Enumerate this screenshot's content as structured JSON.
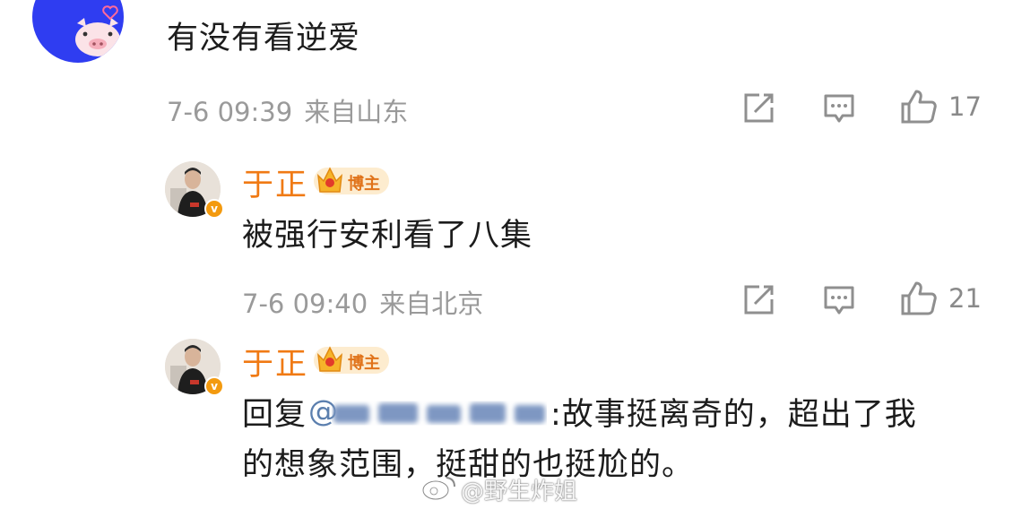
{
  "comment": {
    "text": "有没有看逆爱",
    "time": "7-6 09:39",
    "location": "来自山东",
    "like_count": "17"
  },
  "replies": [
    {
      "username": "于正",
      "badge": "博主",
      "text": "被强行安利看了八集",
      "time": "7-6 09:40",
      "location": "来自北京",
      "like_count": "21"
    },
    {
      "username": "于正",
      "badge": "博主",
      "reply_prefix": "回复",
      "mention": "@",
      "text_line1": ":故事挺离奇的，超出了我",
      "text_line2": "的想象范围，挺甜的也挺尬的。"
    }
  ],
  "watermark": "@野生炸姐",
  "verified_mark": "v",
  "icons": [
    "pig-avatar-icon",
    "share-icon",
    "comment-icon",
    "like-icon",
    "verified-icon",
    "crown-icon",
    "weibo-logo-icon"
  ]
}
